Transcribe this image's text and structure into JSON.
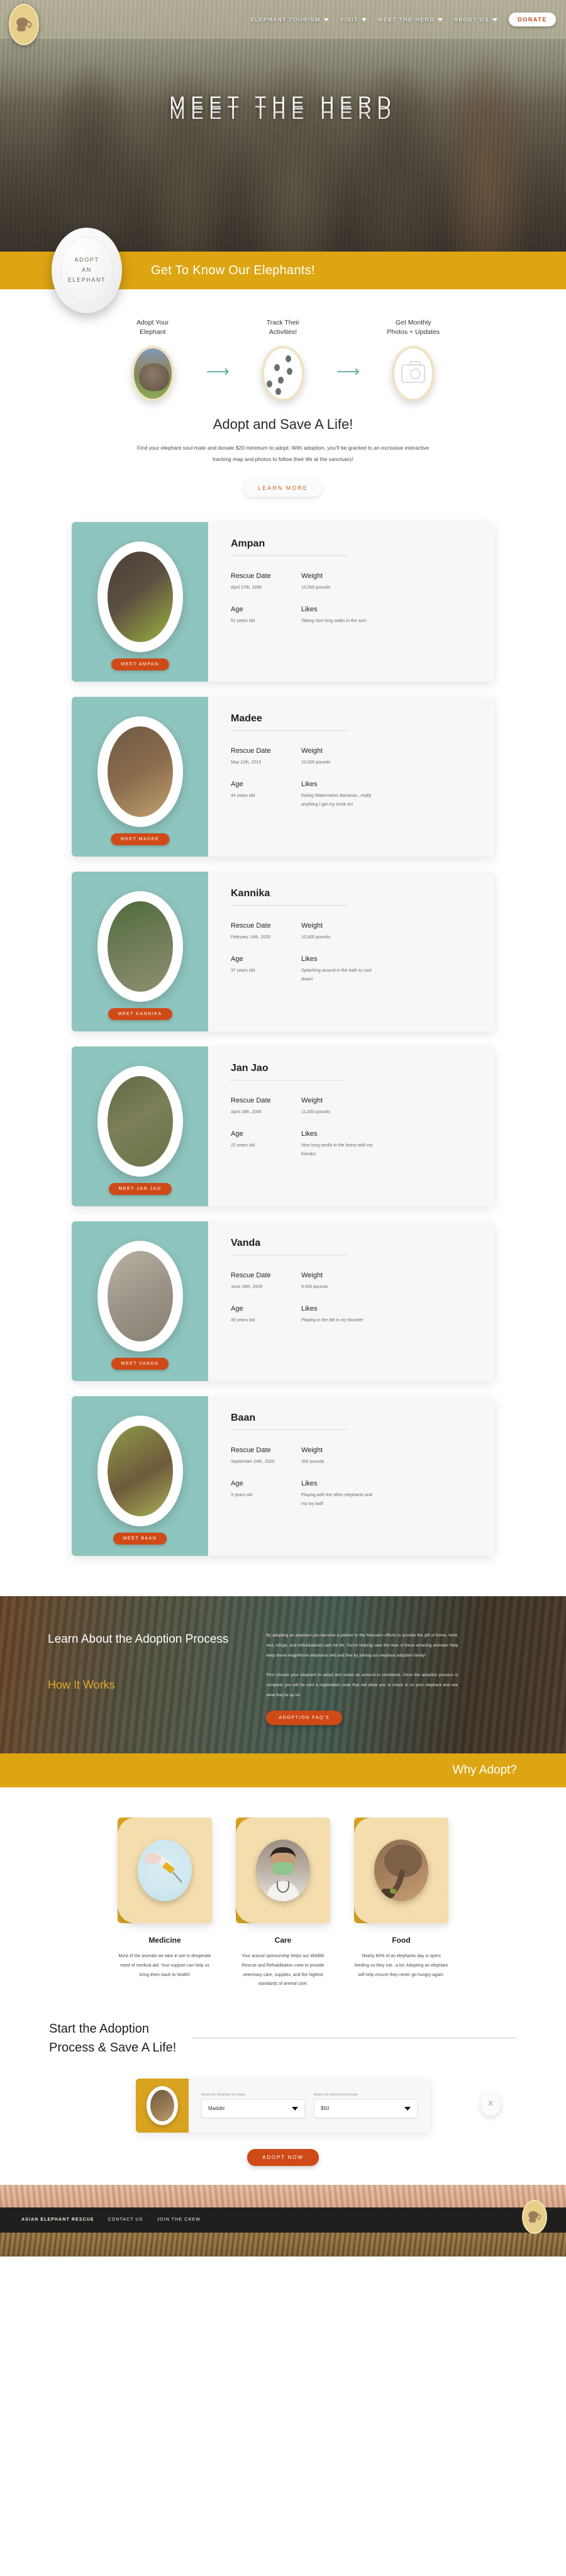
{
  "nav": {
    "items": [
      {
        "label": "ELEPHANT TOURISM",
        "caret": true
      },
      {
        "label": "VISIT",
        "caret": true
      },
      {
        "label": "MEET THE HERD",
        "caret": true
      },
      {
        "label": "ABOUT US",
        "caret": true
      }
    ],
    "donate_label": "DONATE"
  },
  "hero": {
    "title": "MEET THE HERD"
  },
  "banner": {
    "title": "Get  To Know Our Elephants!",
    "badge_line1": "ADOPT",
    "badge_line2": "AN",
    "badge_line3": "ELEPHANT"
  },
  "steps": [
    {
      "label": "Adopt Your\nElephant",
      "icon": "elephant-photo"
    },
    {
      "label": "Track Their\nActivities!",
      "icon": "paw-prints-icon"
    },
    {
      "label": "Get Monthly\nPhotos + Updates",
      "icon": "camera-icon"
    }
  ],
  "intro": {
    "heading": "Adopt and Save A Life!",
    "body": "Find your elephant soul mate and donate $20 minimum to adopt.  With adoption, you'll be granted to an exclusive interactive tracking map and photos to follow their life at the sanctuary!",
    "cta": "LEARN MORE"
  },
  "field_labels": {
    "rescue_date": "Rescue Date",
    "weight": "Weight",
    "age": "Age",
    "likes": "Likes"
  },
  "elephants": [
    {
      "name": "Ampan",
      "rescue_date": "April 27th, 1998",
      "weight": "10,500 pounds",
      "age": "51 years old",
      "likes": "Taking nice long walks in the sun!",
      "button": "MEET AMPAN"
    },
    {
      "name": "Madee",
      "rescue_date": "May 12th, 2015",
      "weight": "10,000 pounds",
      "age": "44 years old",
      "likes": "Eating Watermelon Bananas...really anything I get my trunk on!",
      "button": "MEET MADEE"
    },
    {
      "name": "Kannika",
      "rescue_date": "February 14th, 2020",
      "weight": "10,800 pounds",
      "age": "37 years old",
      "likes": "Splashing around in the bath to cool down!",
      "button": "MEET KANNIKA"
    },
    {
      "name": "Jan Jao",
      "rescue_date": "April 19th, 2005",
      "weight": "11,000 pounds",
      "age": "22 years old",
      "likes": "Nice long strolls in the forest with my friends!",
      "button": "MEET JAN JAO"
    },
    {
      "name": "Vanda",
      "rescue_date": "June 16th, 2009",
      "weight": "9,500 pounds",
      "age": "45 years old",
      "likes": "Playing in the dirt is my favorite!",
      "button": "MEET VANDA"
    },
    {
      "name": "Baan",
      "rescue_date": "September 24th, 2020",
      "weight": "350 pounds",
      "age": "3 years old",
      "likes": "Playing with the other elephants and my toy ball!",
      "button": "MEET BAAN"
    }
  ],
  "learn": {
    "heading": "Learn About the Adoption Process",
    "how_it_works": "How It Works",
    "para1": "By adopting an elephant you become a partner in the Rescue's efforts to provide the gift of home, herd, rest, refuge, and individualized care for life. You're helping save the lives of these amazing animals! Help keep these magnificent elephants wild and free by joining our elephant adoption family!",
    "para2": "First choose your elephant to adopt and select an amount to contribute. Once the adoption process is complete you will be sent a registration code that will allow you to check in on your elephant and see what they're up to!",
    "cta": "ADOPTION FAQ'S"
  },
  "why_banner": {
    "title": "Why Adopt?"
  },
  "benefits": [
    {
      "title": "Medicine",
      "text": "Most of the animals we take in are in desperate need of medical aid.  Your support can help us bring them back to health!",
      "icon": "syringe-photo"
    },
    {
      "title": "Care",
      "text": "Your animal sponsorship helps our Wildlife Rescue and Rehabilitation crew to provide veterinary care, supplies, and the highest standards of animal care.",
      "icon": "veterinarian-photo"
    },
    {
      "title": "Food",
      "text": "Nearly 80% of an elephants day is spent feeding so they eat...a lot. Adopting an elephant will help ensure they never go hungry again.",
      "icon": "elephant-eating-photo"
    }
  ],
  "adopt_form": {
    "heading": "Start the Adoption\nProcess & Save A Life!",
    "elephant_label": "Select An Elephant to Adopt",
    "elephant_value": "Maddie",
    "amount_label": "Select An Amount to Donate",
    "amount_value": "$50",
    "close_glyph": "X",
    "cta": "ADOPT NOW"
  },
  "footer": {
    "links": [
      "ASIAN ELEPHANT RESCUE",
      "CONTACT US",
      "JOIN THE CREW"
    ]
  },
  "colors": {
    "gold": "#dda512",
    "orange": "#cf4a17",
    "teal": "#8fc5bf",
    "dark": "#201f1d"
  }
}
